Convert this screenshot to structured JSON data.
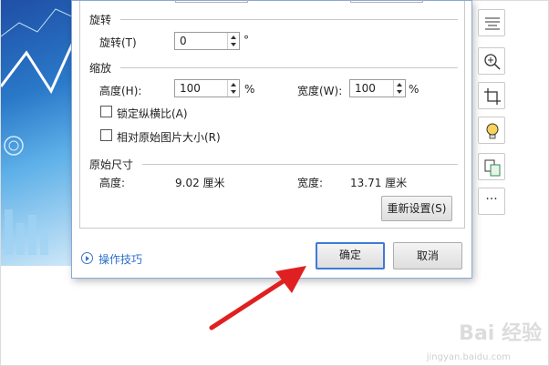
{
  "dialog": {
    "rotate": {
      "section_title": "旋转",
      "label": "旋转(T)",
      "value": "0",
      "unit": "°"
    },
    "scale": {
      "section_title": "缩放",
      "height_label": "高度(H):",
      "height_value": "100",
      "height_unit": "%",
      "width_label": "宽度(W):",
      "width_value": "100",
      "width_unit": "%",
      "lock_ratio_label": "锁定纵横比(A)",
      "relative_label": "相对原始图片大小(R)"
    },
    "original_size": {
      "section_title": "原始尺寸",
      "height_label": "高度:",
      "height_value": "9.02 厘米",
      "width_label": "宽度:",
      "width_value": "13.71 厘米"
    },
    "reset_button": "重新设置(S)",
    "tips_link": "操作技巧",
    "ok_button": "确定",
    "cancel_button": "取消"
  },
  "toolbar": {
    "icons": [
      "text-wrap-icon",
      "zoom-icon",
      "crop-icon",
      "idea-icon",
      "convert-icon",
      "more-icon"
    ],
    "more_label": "···"
  },
  "colors": {
    "arrow": "#e02020",
    "primary_border": "#3d7bd6",
    "link": "#3a74c9"
  },
  "watermark": {
    "brand": "Bai 经验",
    "url": "jingyan.baidu.com"
  }
}
